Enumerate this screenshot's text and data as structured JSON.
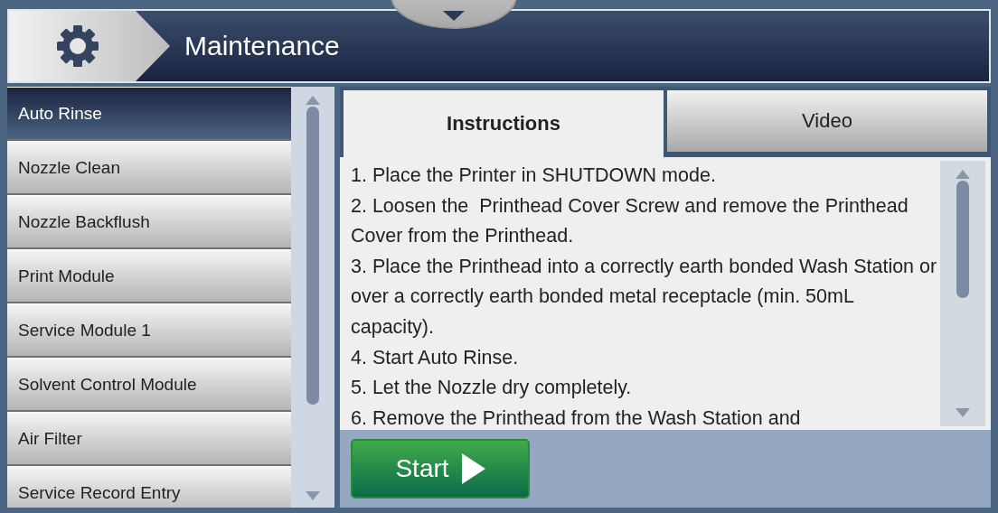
{
  "header": {
    "title": "Maintenance"
  },
  "menu": [
    {
      "label": "Auto Rinse",
      "selected": true
    },
    {
      "label": "Nozzle Clean",
      "selected": false
    },
    {
      "label": "Nozzle Backflush",
      "selected": false
    },
    {
      "label": "Print Module",
      "selected": false
    },
    {
      "label": "Service Module 1",
      "selected": false
    },
    {
      "label": "Solvent Control Module",
      "selected": false
    },
    {
      "label": "Air Filter",
      "selected": false
    },
    {
      "label": "Service Record Entry",
      "selected": false
    }
  ],
  "tabs": [
    {
      "label": "Instructions",
      "selected": true
    },
    {
      "label": "Video",
      "selected": false
    }
  ],
  "instructions": [
    "1. Place the Printer in SHUTDOWN mode.",
    "2. Loosen the  Printhead Cover Screw and remove the Printhead Cover from the Printhead.",
    "3. Place the Printhead into a correctly earth bonded Wash Station or over a correctly earth bonded metal receptacle (min. 50mL capacity).",
    "4. Start Auto Rinse.",
    "5. Let the Nozzle dry completely.",
    "6. Remove the Printhead from the Wash Station and"
  ],
  "start_button": {
    "label": "Start"
  }
}
